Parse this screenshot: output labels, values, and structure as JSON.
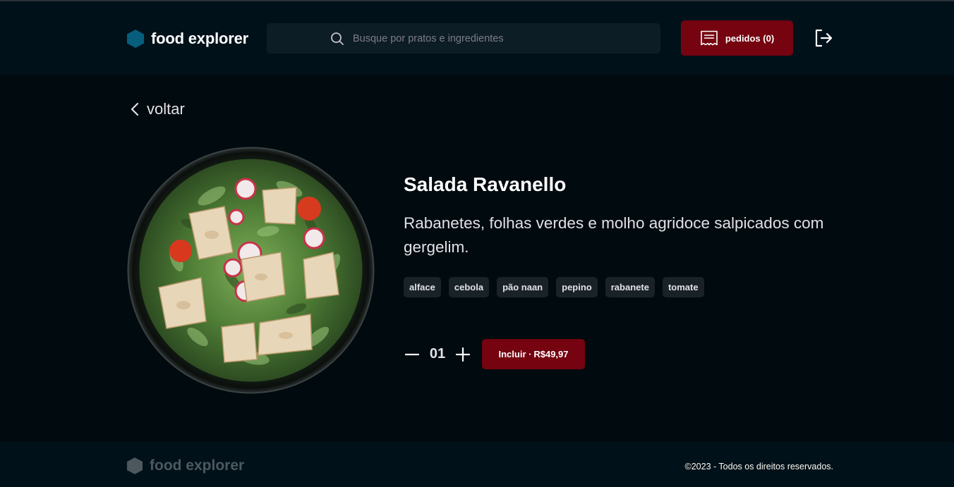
{
  "header": {
    "brand": "food explorer",
    "search_placeholder": "Busque por pratos e ingredientes",
    "orders_label": "pedidos (0)"
  },
  "nav": {
    "back_label": "voltar"
  },
  "dish": {
    "name": "Salada Ravanello",
    "description": "Rabanetes, folhas verdes e molho agridoce salpicados com gergelim.",
    "ingredients": [
      "alface",
      "cebola",
      "pão naan",
      "pepino",
      "rabanete",
      "tomate"
    ],
    "quantity": "01",
    "add_label": "Incluir ∙ R$49,97"
  },
  "footer": {
    "brand": "food explorer",
    "copyright": "©2023 - Todos os direitos reservados."
  },
  "colors": {
    "accent": "#750310",
    "brand_hex": "#065E7C",
    "header_bg": "#00111A",
    "page_bg": "#000A0F"
  },
  "icons": [
    "hexagon-logo-icon",
    "search-icon",
    "receipt-icon",
    "sign-out-icon",
    "chevron-left-icon",
    "minus-icon",
    "plus-icon"
  ]
}
